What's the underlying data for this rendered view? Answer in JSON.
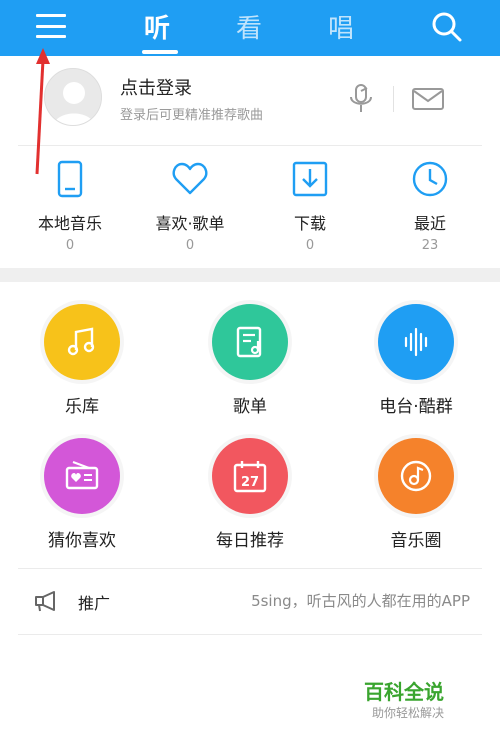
{
  "header": {
    "tabs": [
      {
        "label": "听",
        "active": true
      },
      {
        "label": "看",
        "active": false
      },
      {
        "label": "唱",
        "active": false
      }
    ],
    "menu_icon": "hamburger-menu-icon",
    "search_icon": "search-icon",
    "bar_color": "#1f9ef3"
  },
  "profile": {
    "title": "点击登录",
    "subtitle": "登录后可更精准推荐歌曲",
    "avatar_icon": "avatar-placeholder-icon",
    "mic_icon": "microphone-icon",
    "mail_icon": "mail-icon"
  },
  "quick_access": [
    {
      "label": "本地音乐",
      "count": "0",
      "icon": "phone-icon"
    },
    {
      "label": "喜欢·歌单",
      "count": "0",
      "icon": "heart-icon"
    },
    {
      "label": "下载",
      "count": "0",
      "icon": "download-icon"
    },
    {
      "label": "最近",
      "count": "23",
      "icon": "clock-icon"
    }
  ],
  "features": [
    {
      "label": "乐库",
      "icon": "music-note-icon",
      "color": "#f7c21a"
    },
    {
      "label": "歌单",
      "icon": "playlist-icon",
      "color": "#2fc79a"
    },
    {
      "label": "电台·酷群",
      "icon": "soundwave-icon",
      "color": "#1f9ef3"
    },
    {
      "label": "猜你喜欢",
      "icon": "radio-heart-icon",
      "color": "#d357d8"
    },
    {
      "label": "每日推荐",
      "icon": "calendar-icon",
      "calendar_day": "27",
      "color": "#f2575f"
    },
    {
      "label": "音乐圈",
      "icon": "music-circle-icon",
      "color": "#f5822b"
    }
  ],
  "promo": {
    "label": "推广",
    "text": "5sing，听古风的人都在用的APP",
    "icon": "megaphone-icon"
  },
  "watermark": {
    "title": "百科全说",
    "subtitle": "助你轻松解决"
  }
}
